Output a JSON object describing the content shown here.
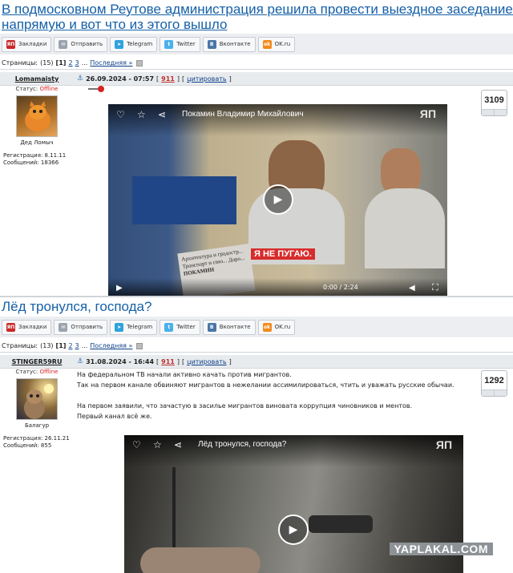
{
  "post1": {
    "title": "В подмосковном Реутове администрация решила провести выездное заседание для с",
    "title_line2": "напрямую и вот что из этого вышло",
    "share": [
      "Закладки",
      "Отправить",
      "Telegram",
      "Twitter",
      "Вконтакте",
      "OK.ru"
    ],
    "pager": {
      "prefix": "Страницы:",
      "count": "(15)",
      "current": "[1]",
      "p2": "2",
      "p3": "3",
      "dots": "...",
      "last": "Последняя »"
    },
    "user": "Lomamaisty",
    "date": "26.09.2024 - 07:57",
    "post_num": "911",
    "cite": "цитировать",
    "status_label": "Статус:",
    "status": "Offline",
    "user_caption": "Дед Ломыч",
    "reg": "Регистрация: 8.11.11",
    "msgs": "Сообщений: 18366",
    "rating": "3109",
    "video": {
      "title": "Покамин Владимир Михайлович",
      "caption": "Я НЕ ПУГАЮ.",
      "time": "0:00",
      "sep": "/",
      "duration": "2:24",
      "sign": "Архитектура и градостр... Транспорт и связ... Доро...",
      "sign2": "ПОКАМИН",
      "logo": "ЯП"
    }
  },
  "post2": {
    "title": "Лёд тронулся, господа?",
    "share": [
      "Закладки",
      "Отправить",
      "Telegram",
      "Twitter",
      "Вконтакте",
      "OK.ru"
    ],
    "pager": {
      "prefix": "Страницы:",
      "count": "(13)",
      "current": "[1]",
      "p2": "2",
      "p3": "3",
      "dots": "...",
      "last": "Последняя »"
    },
    "user": "STINGER59RU",
    "date": "31.08.2024 - 16:44",
    "post_num": "911",
    "cite": "цитировать",
    "status_label": "Статус:",
    "status": "Offline",
    "user_caption": "Балагур",
    "reg": "Регистрация: 26.11.21",
    "msgs": "Сообщений: 855",
    "rating": "1292",
    "body": [
      "На федеральном ТВ начали активно качать против мигрантов.",
      "Так на первом канале обвиняют мигрантов в нежелании ассимилироваться, чтить и уважать русские обычаи.",
      "",
      "На первом заявили, что зачастую в засилье мигрантов виновата коррупция чиновников и ментов.",
      "Первый канал всё же."
    ],
    "video": {
      "title": "Лёд тронулся, господа?",
      "logo": "ЯП"
    }
  },
  "watermark": "YAPLAKAL.COM",
  "colors": {
    "title": "#1560a8",
    "offline": "#d82020",
    "post_num": "#c03030"
  }
}
